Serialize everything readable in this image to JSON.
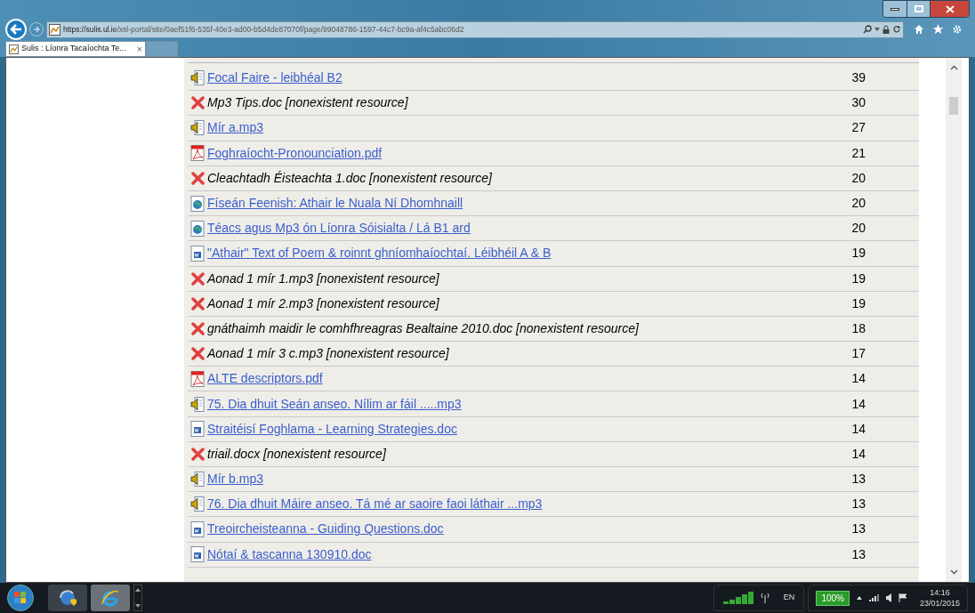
{
  "browser": {
    "url_host": "https://sulis.ul.ie",
    "url_path": "/xsl-portal/site/0aef51f6-535f-40e3-ad00-b5d4de87070f/page/99048786-1597-44c7-bc9a-af4c5abc06d2",
    "tab": {
      "title": "Sulis : Líonra Tacaíochta Te...",
      "close": "×",
      "selected": true
    }
  },
  "resources": [
    {
      "kind": "audio",
      "name": "Focal Faire - leibhéal B2",
      "count": "39"
    },
    {
      "kind": "missing",
      "name": "Mp3 Tips.doc [nonexistent resource]",
      "count": "30"
    },
    {
      "kind": "audio",
      "name": "Mír a.mp3",
      "count": "27"
    },
    {
      "kind": "pdf",
      "name": "Foghraíocht-Pronounciation.pdf",
      "count": "21"
    },
    {
      "kind": "missing",
      "name": "Cleachtadh Éisteachta 1.doc [nonexistent resource]",
      "count": "20"
    },
    {
      "kind": "web",
      "name": "Físeán Feenish: Athair le Nuala Ní Dhomhnaill",
      "count": "20"
    },
    {
      "kind": "web",
      "name": "Téacs agus Mp3 ón Líonra Sóisialta / Lá B1 ard",
      "count": "20"
    },
    {
      "kind": "word",
      "name": "\"Athair\" Text of Poem & roinnt ghníomhaíochtaí. Léibhéil A & B",
      "count": "19"
    },
    {
      "kind": "missing",
      "name": "Aonad 1 mír 1.mp3 [nonexistent resource]",
      "count": "19"
    },
    {
      "kind": "missing",
      "name": "Aonad 1 mír 2.mp3 [nonexistent resource]",
      "count": "19"
    },
    {
      "kind": "missing",
      "name": "gnáthaimh maidir le comhfhreagras Bealtaine 2010.doc [nonexistent resource]",
      "count": "18"
    },
    {
      "kind": "missing",
      "name": "Aonad 1 mír 3 c.mp3 [nonexistent resource]",
      "count": "17"
    },
    {
      "kind": "pdf",
      "name": "ALTE descriptors.pdf",
      "count": "14"
    },
    {
      "kind": "audio",
      "name": "75. Dia dhuit Seán anseo. Nílim ar fáil .....mp3",
      "count": "14"
    },
    {
      "kind": "word",
      "name": "Straitéisí Foghlama - Learning Strategies.doc",
      "count": "14"
    },
    {
      "kind": "missing",
      "name": "triail.docx [nonexistent resource]",
      "count": "14"
    },
    {
      "kind": "audio",
      "name": "Mír b.mp3",
      "count": "13"
    },
    {
      "kind": "audio",
      "name": "76. Dia dhuit Máire anseo. Tá mé ar saoire faoi láthair ...mp3",
      "count": "13"
    },
    {
      "kind": "word",
      "name": "Treoircheisteanna - Guiding Questions.doc",
      "count": "13"
    },
    {
      "kind": "word",
      "name": "Nótaí & tascanna 130910.doc",
      "count": "13"
    }
  ],
  "taskbar": {
    "language": "EN",
    "battery": "100%",
    "time": "14:16",
    "date": "23/01/2015"
  }
}
